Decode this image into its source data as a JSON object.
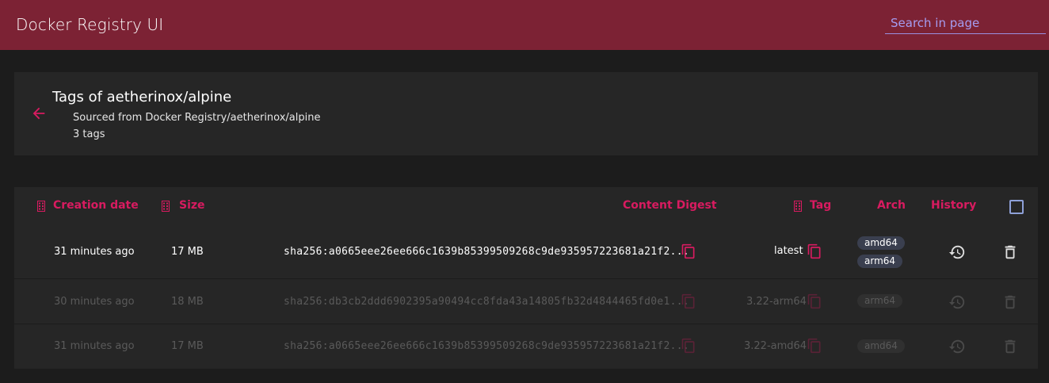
{
  "appbar": {
    "title": "Docker Registry UI",
    "search_placeholder": "Search in page"
  },
  "header": {
    "title": "Tags of aetherinox/alpine",
    "source": "Sourced from Docker Registry/aetherinox/alpine",
    "count": "3 tags"
  },
  "table": {
    "columns": {
      "creation_date": "Creation date",
      "size": "Size",
      "content_digest": "Content Digest",
      "tag": "Tag",
      "arch": "Arch",
      "history": "History"
    },
    "rows": [
      {
        "creation_date": "31 minutes ago",
        "size": "17 MB",
        "digest": "sha256:a0665eee26ee666c1639b85399509268c9de935957223681a21f2...",
        "tag": "latest",
        "arch": [
          "amd64",
          "arm64"
        ]
      },
      {
        "creation_date": "30 minutes ago",
        "size": "18 MB",
        "digest": "sha256:db3cb2ddd6902395a90494cc8fda43a14805fb32d4844465fd0e1...",
        "tag": "3.22-arm64",
        "arch": [
          "arm64"
        ]
      },
      {
        "creation_date": "31 minutes ago",
        "size": "17 MB",
        "digest": "sha256:a0665eee26ee666c1639b85399509268c9de935957223681a21f2...",
        "tag": "3.22-amd64",
        "arch": [
          "amd64"
        ]
      }
    ]
  },
  "icons": {
    "back": "arrow-left-icon",
    "sort": "sort-icon",
    "copy": "copy-icon",
    "history": "history-icon",
    "delete": "trash-icon"
  },
  "colors": {
    "appbar": "#7c2234",
    "accent": "#d81b60",
    "search_text": "#a59cf0",
    "badge": "#3a3f4f"
  }
}
